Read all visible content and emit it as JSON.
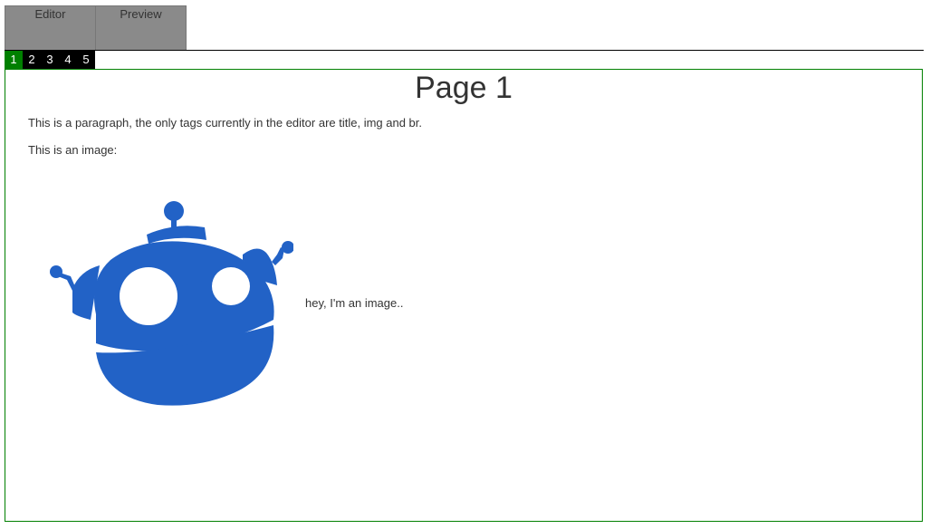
{
  "tabs": [
    {
      "label": "Editor"
    },
    {
      "label": "Preview"
    }
  ],
  "pages": [
    "1",
    "2",
    "3",
    "4",
    "5"
  ],
  "active_page": "1",
  "content": {
    "title": "Page 1",
    "paragraph1": "This is a paragraph, the only tags currently in the editor are title, img and br.",
    "paragraph2": "This is an image:",
    "image_caption": "hey, I'm an image.."
  },
  "colors": {
    "accent": "#008000",
    "tab_bg": "#8a8a8a",
    "robot": "#2262c6"
  },
  "image": {
    "icon": "robot-icon"
  }
}
